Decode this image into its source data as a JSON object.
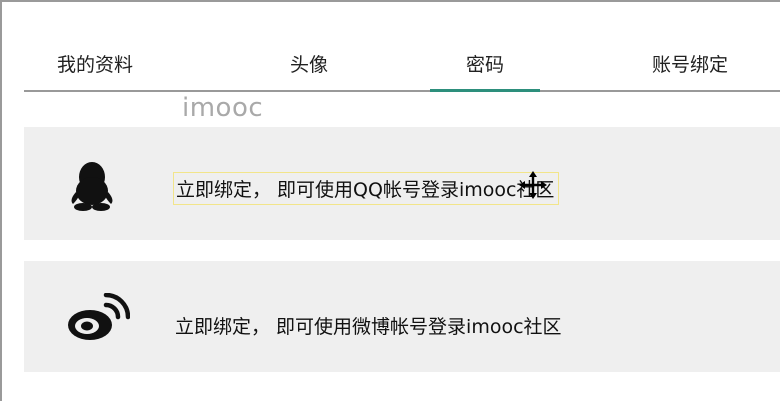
{
  "tabs": [
    {
      "label": "我的资料"
    },
    {
      "label": "头像"
    },
    {
      "label": "密码"
    },
    {
      "label": "账号绑定"
    }
  ],
  "active_tab_index": 2,
  "watermark": "imooc",
  "bindings": {
    "qq": {
      "icon": "qq-penguin-icon",
      "text": "立即绑定， 即可使用QQ帐号登录imooc社区"
    },
    "weibo": {
      "icon": "weibo-icon",
      "text": "立即绑定， 即可使用微博帐号登录imooc社区"
    }
  },
  "colors": {
    "accent": "#2d8f7c",
    "card_bg": "#efefef",
    "highlight_border": "#f2e58a"
  }
}
